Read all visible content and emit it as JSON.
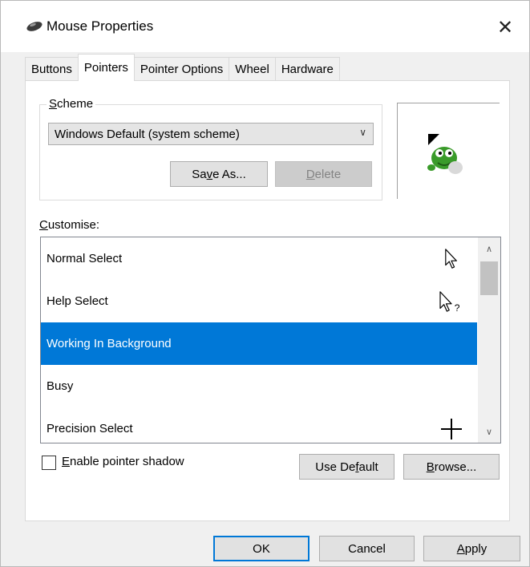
{
  "window": {
    "title": "Mouse Properties",
    "close_glyph": "✕",
    "icon": "mouse-icon"
  },
  "tabs": [
    {
      "label": "Buttons",
      "active": false
    },
    {
      "label": "Pointers",
      "active": true
    },
    {
      "label": "Pointer Options",
      "active": false
    },
    {
      "label": "Wheel",
      "active": false
    },
    {
      "label": "Hardware",
      "active": false
    }
  ],
  "scheme": {
    "label_mnemonic": "S",
    "label_rest": "cheme",
    "selected": "Windows Default (system scheme)",
    "save_as_pre": "Sa",
    "save_as_mnemonic": "v",
    "save_as_post": "e As...",
    "delete_mnemonic": "D",
    "delete_rest": "elete"
  },
  "customise": {
    "label_mnemonic": "C",
    "label_rest": "ustomise:",
    "rows": [
      {
        "label": "Normal Select",
        "icon": "arrow-cursor-icon",
        "selected": false
      },
      {
        "label": "Help Select",
        "icon": "help-cursor-icon",
        "selected": false
      },
      {
        "label": "Working In Background",
        "icon": "",
        "selected": true
      },
      {
        "label": "Busy",
        "icon": "",
        "selected": false
      },
      {
        "label": "Precision Select",
        "icon": "crosshair-cursor-icon",
        "selected": false
      }
    ]
  },
  "shadow": {
    "label_mnemonic": "E",
    "label_rest": "nable pointer shadow",
    "checked": false
  },
  "buttons": {
    "use_default_pre": "Use De",
    "use_default_mnemonic": "f",
    "use_default_post": "ault",
    "browse_mnemonic": "B",
    "browse_rest": "rowse...",
    "ok": "OK",
    "cancel": "Cancel",
    "apply_mnemonic": "A",
    "apply_rest": "pply"
  },
  "colors": {
    "selection": "#0078d7",
    "default_button_border": "#0078d7"
  }
}
